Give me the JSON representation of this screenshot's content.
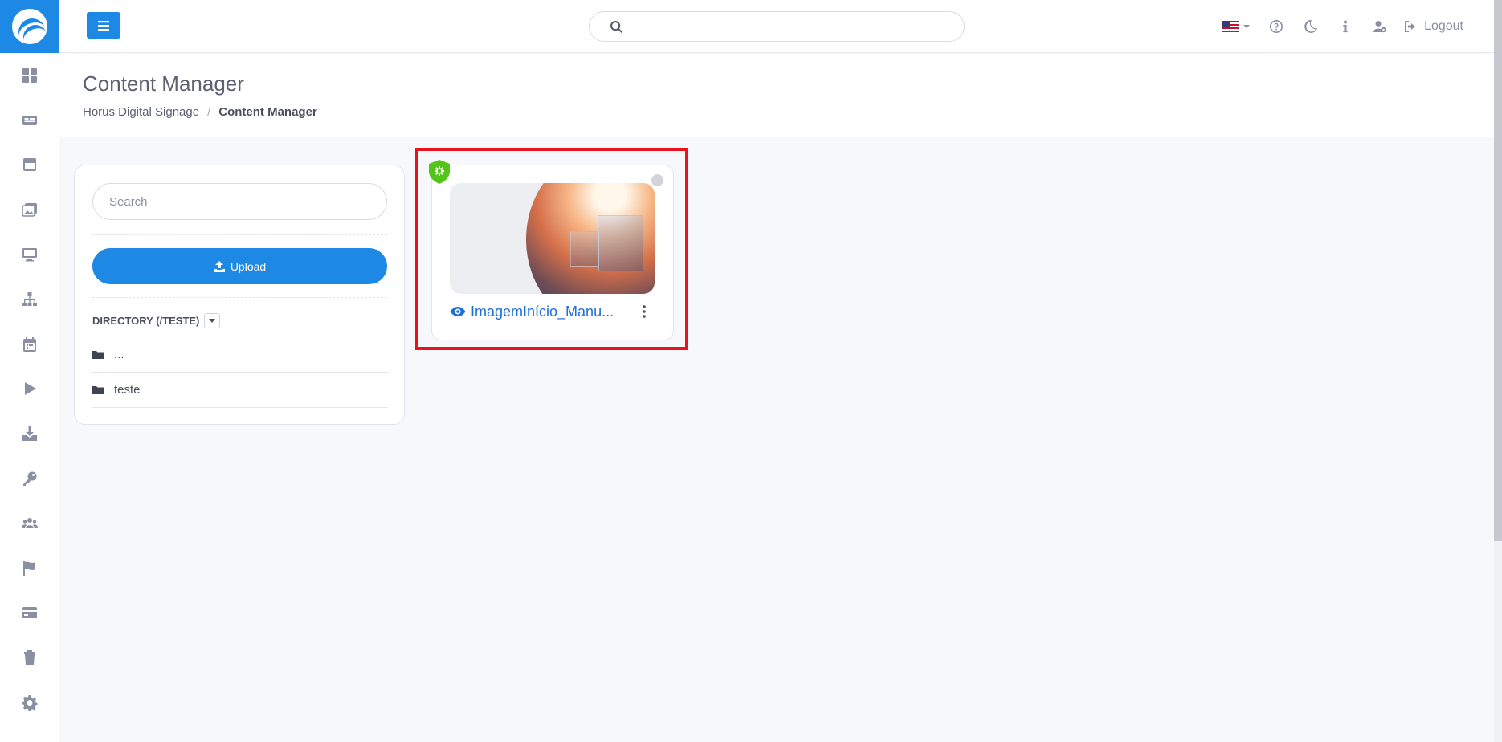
{
  "sidebar": {
    "items": [
      {
        "icon": "dashboard-icon"
      },
      {
        "icon": "media-icon"
      },
      {
        "icon": "layout-icon"
      },
      {
        "icon": "gallery-icon"
      },
      {
        "icon": "monitor-icon"
      },
      {
        "icon": "sitemap-icon"
      },
      {
        "icon": "calendar-icon"
      },
      {
        "icon": "play-icon"
      },
      {
        "icon": "download-icon"
      },
      {
        "icon": "key-icon"
      },
      {
        "icon": "users-icon"
      },
      {
        "icon": "flag-icon"
      },
      {
        "icon": "card-icon"
      },
      {
        "icon": "trash-icon"
      },
      {
        "icon": "gear-icon"
      }
    ]
  },
  "topbar": {
    "search_placeholder": "",
    "search_value": "",
    "logout_label": "Logout",
    "language": "en-US"
  },
  "header": {
    "title": "Content Manager",
    "breadcrumb": [
      "Horus Digital Signage",
      "Content Manager"
    ]
  },
  "panel": {
    "search_placeholder": "Search",
    "upload_label": "Upload",
    "directory_label": "DIRECTORY (/TESTE)",
    "directories": [
      {
        "name": "..."
      },
      {
        "name": "teste"
      }
    ]
  },
  "file": {
    "name": "ImagemInício_Manu...",
    "status_color": "#52c41a"
  },
  "colors": {
    "accent": "#1e88e5",
    "highlight": "#e8141c"
  }
}
